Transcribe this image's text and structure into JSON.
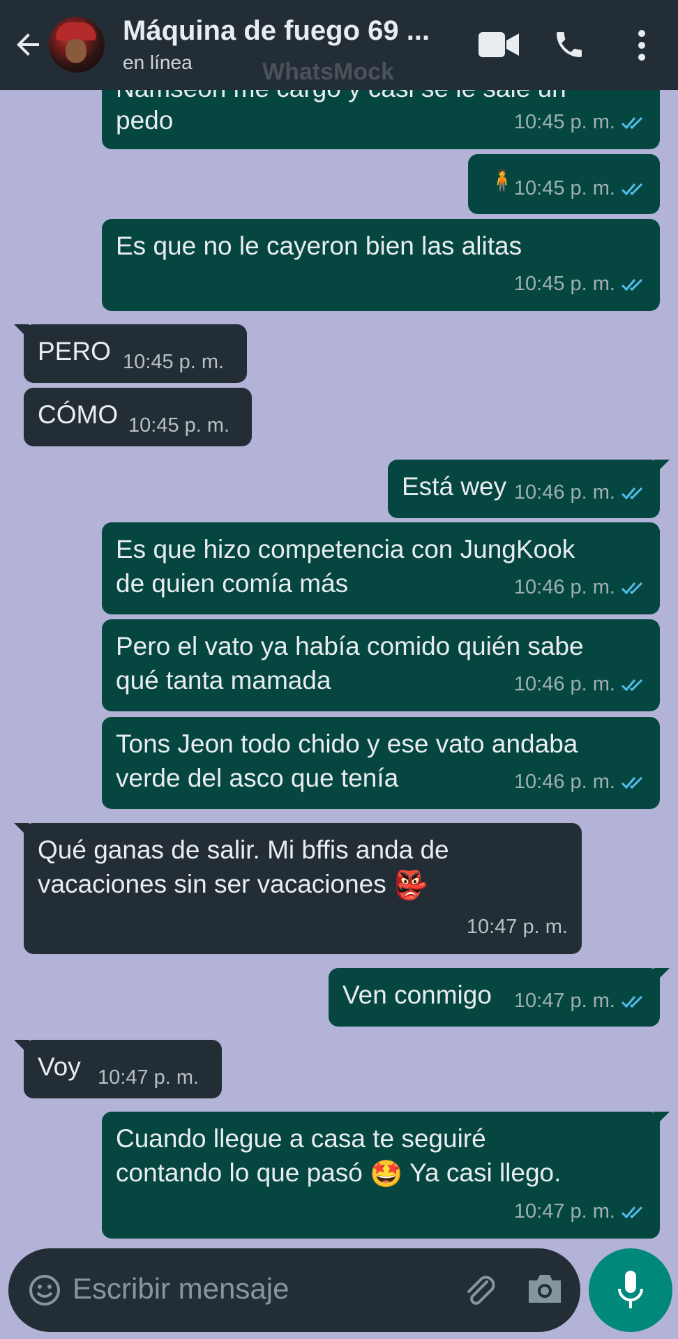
{
  "header": {
    "contact_name": "Máquina de fuego 69 ...",
    "status": "en línea",
    "watermark": "WhatsMock"
  },
  "messages": [
    {
      "dir": "out",
      "text": "Namseon me cargo y casi se le sale un",
      "text2": "pedo",
      "time": "10:45 p. m."
    },
    {
      "dir": "out",
      "text": "🧍",
      "time": "10:45 p. m."
    },
    {
      "dir": "out",
      "text": "Es que no le cayeron bien las alitas",
      "time": "10:45 p. m."
    },
    {
      "dir": "in",
      "text": "PERO",
      "time": "10:45 p. m."
    },
    {
      "dir": "in",
      "text": "CÓMO",
      "time": "10:45 p. m."
    },
    {
      "dir": "out",
      "text": "Está wey",
      "time": "10:46 p. m."
    },
    {
      "dir": "out",
      "text": "Es que hizo competencia con JungKook",
      "text2": "de quien comía más",
      "time": "10:46 p. m."
    },
    {
      "dir": "out",
      "text": "Pero el vato ya había comido quién sabe",
      "text2": "qué tanta mamada",
      "time": "10:46 p. m."
    },
    {
      "dir": "out",
      "text": "Tons Jeon todo chido y ese vato andaba",
      "text2": "verde del asco que tenía",
      "time": "10:46 p. m."
    },
    {
      "dir": "in",
      "text": "Qué ganas de salir. Mi bffis anda de",
      "text2": "vacaciones sin ser vacaciones",
      "emoji": "👺",
      "time": "10:47 p. m."
    },
    {
      "dir": "out",
      "text": "Ven conmigo",
      "time": "10:47 p. m."
    },
    {
      "dir": "in",
      "text": "Voy",
      "time": "10:47 p. m."
    },
    {
      "dir": "out",
      "text": "Cuando llegue a casa te seguiré",
      "text2": "contando lo que pasó",
      "emoji": "🤩",
      "text3": "Ya casi llego.",
      "time": "10:47 p. m."
    }
  ],
  "input": {
    "placeholder": "Escribir mensaje"
  },
  "icons": {
    "back": "arrow-left-icon",
    "video": "video-call-icon",
    "call": "phone-icon",
    "menu": "more-vert-icon",
    "emoji": "emoji-icon",
    "attach": "paperclip-icon",
    "camera": "camera-icon",
    "mic": "microphone-icon",
    "read": "double-check-icon"
  },
  "colors": {
    "outgoing_bubble": "#054740",
    "incoming_bubble": "#232d36",
    "wallpaper": "#b3b3d7",
    "header": "#232d36",
    "mic_button": "#00897b",
    "read_ticks": "#53bdeb"
  }
}
